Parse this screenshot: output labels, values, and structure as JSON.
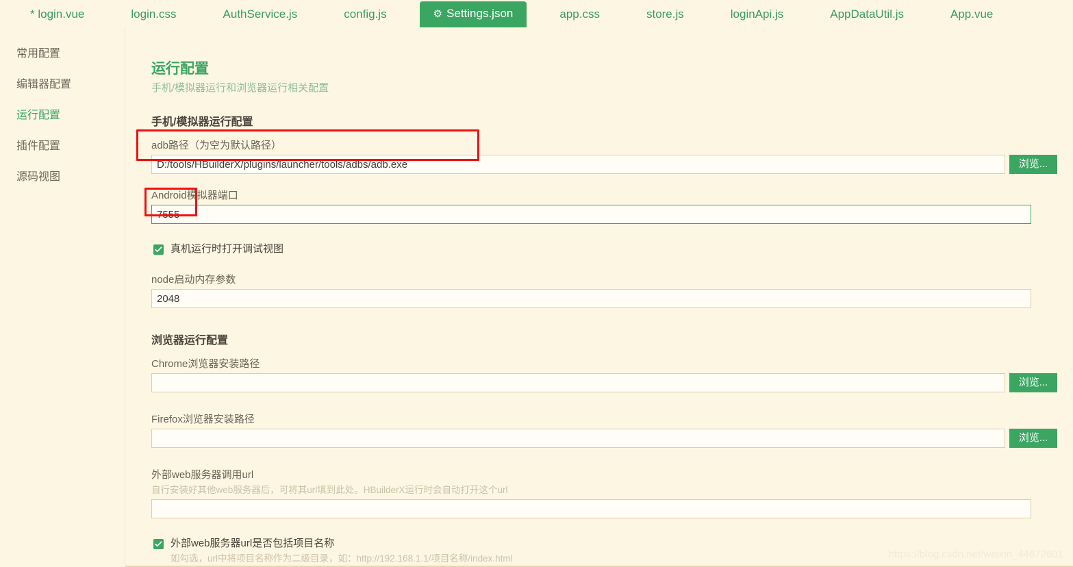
{
  "tabs": [
    {
      "label": "* login.vue",
      "active": false,
      "icon": ""
    },
    {
      "label": "login.css",
      "active": false,
      "icon": ""
    },
    {
      "label": "AuthService.js",
      "active": false,
      "icon": ""
    },
    {
      "label": "config.js",
      "active": false,
      "icon": ""
    },
    {
      "label": "Settings.json",
      "active": true,
      "icon": "gear-icon"
    },
    {
      "label": "app.css",
      "active": false,
      "icon": ""
    },
    {
      "label": "store.js",
      "active": false,
      "icon": ""
    },
    {
      "label": "loginApi.js",
      "active": false,
      "icon": ""
    },
    {
      "label": "AppDataUtil.js",
      "active": false,
      "icon": ""
    },
    {
      "label": "App.vue",
      "active": false,
      "icon": ""
    }
  ],
  "sidebar": {
    "items": [
      {
        "label": "常用配置",
        "active": false
      },
      {
        "label": "编辑器配置",
        "active": false
      },
      {
        "label": "运行配置",
        "active": true
      },
      {
        "label": "插件配置",
        "active": false
      },
      {
        "label": "源码视图",
        "active": false
      }
    ]
  },
  "page": {
    "title": "运行配置",
    "subtitle": "手机/模拟器运行和浏览器运行相关配置"
  },
  "section_device": {
    "title": "手机/模拟器运行配置",
    "adb": {
      "label": "adb路径（为空为默认路径）",
      "value": "D:/tools/HBuilderX/plugins/launcher/tools/adbs/adb.exe",
      "placeholder": "",
      "browse_label": "浏览..."
    },
    "port": {
      "label": "Android模拟器端口",
      "value": "7555",
      "placeholder": ""
    },
    "debug_view": {
      "label": "真机运行时打开调试视图",
      "checked": true
    },
    "node_memory": {
      "label": "node启动内存参数",
      "value": "2048",
      "placeholder": ""
    }
  },
  "section_browser": {
    "title": "浏览器运行配置",
    "chrome": {
      "label": "Chrome浏览器安装路径",
      "value": "",
      "placeholder": "",
      "browse_label": "浏览..."
    },
    "firefox": {
      "label": "Firefox浏览器安装路径",
      "value": "",
      "placeholder": "",
      "browse_label": "浏览..."
    },
    "external_url": {
      "label": "外部web服务器调用url",
      "hint": "自行安装好其他web服务器后，可将其url填到此处。HBuilderX运行时会自动打开这个url",
      "value": "",
      "placeholder": ""
    },
    "include_project_name": {
      "label": "外部web服务器url是否包括项目名称",
      "hint": "如勾选，url中将项目名称作为二级目录，如：http://192.168.1.1/项目名称/index.html",
      "checked": true
    }
  },
  "watermark": "https://blog.csdn.net/weixin_44672601",
  "colors": {
    "accent": "#3aa662",
    "background": "#fdf6e3",
    "annotation": "#ee1111",
    "input_border": "#dbd0ab",
    "muted_text": "#cbc2a7"
  }
}
